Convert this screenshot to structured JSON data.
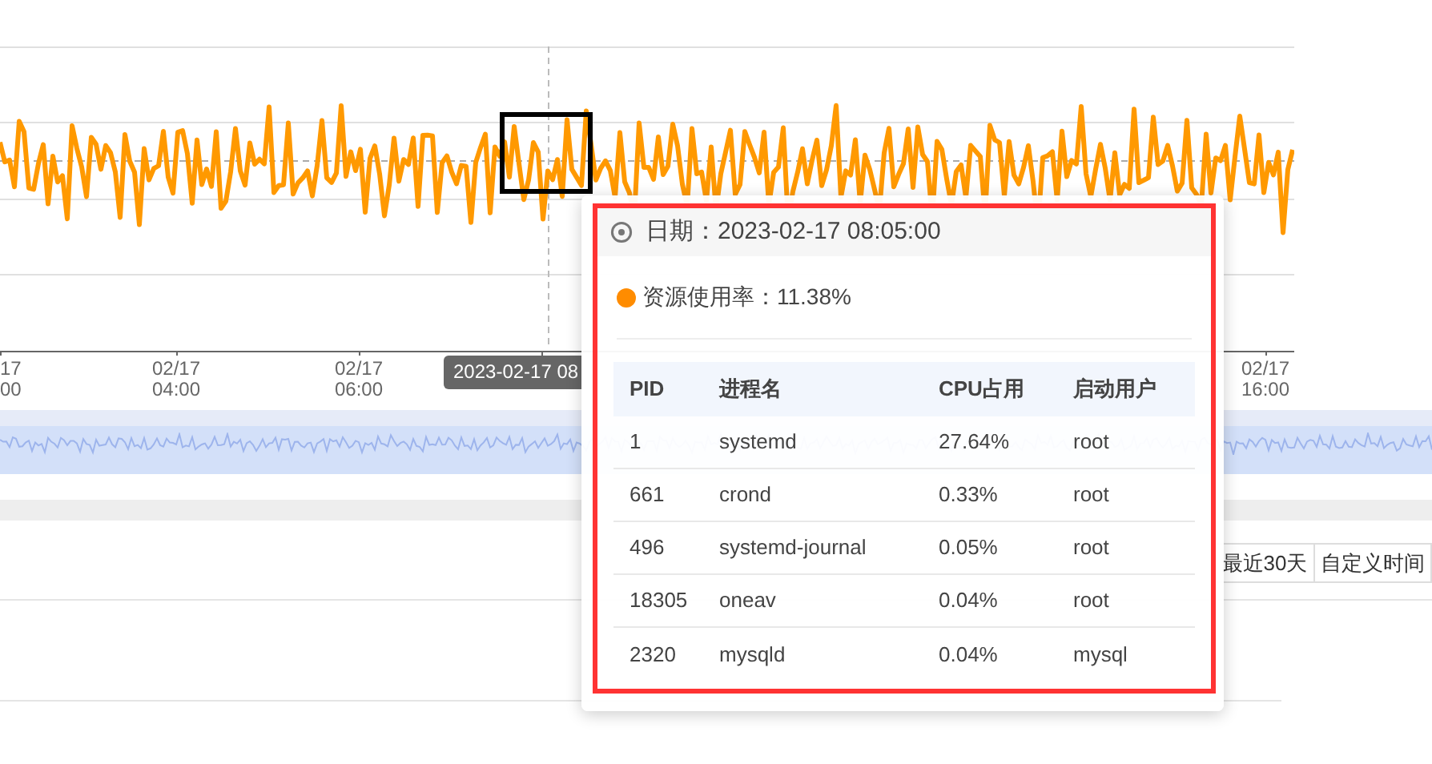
{
  "chart": {
    "x_labels": [
      {
        "date": "17",
        "time": "00"
      },
      {
        "date": "02/17",
        "time": "04:00"
      },
      {
        "date": "02/17",
        "time": "06:00"
      },
      {
        "date": "02/17",
        "time": "16:00"
      }
    ],
    "pointer_label": "2023-02-17 08"
  },
  "range_buttons": [
    "最近30天",
    "自定义时间"
  ],
  "tooltip": {
    "date_label": "日期：",
    "date": "2023-02-17 08:05:00",
    "series": {
      "name": "资源使用率：",
      "value": "11.38%",
      "color": "#ff8c00"
    },
    "table": {
      "columns": [
        "PID",
        "进程名",
        "CPU占用",
        "启动用户"
      ],
      "rows": [
        [
          "1",
          "systemd",
          "27.64%",
          "root"
        ],
        [
          "661",
          "crond",
          "0.33%",
          "root"
        ],
        [
          "496",
          "systemd-journal",
          "0.05%",
          "root"
        ],
        [
          "18305",
          "oneav",
          "0.04%",
          "root"
        ],
        [
          "2320",
          "mysqld",
          "0.04%",
          "mysql"
        ]
      ]
    }
  }
}
